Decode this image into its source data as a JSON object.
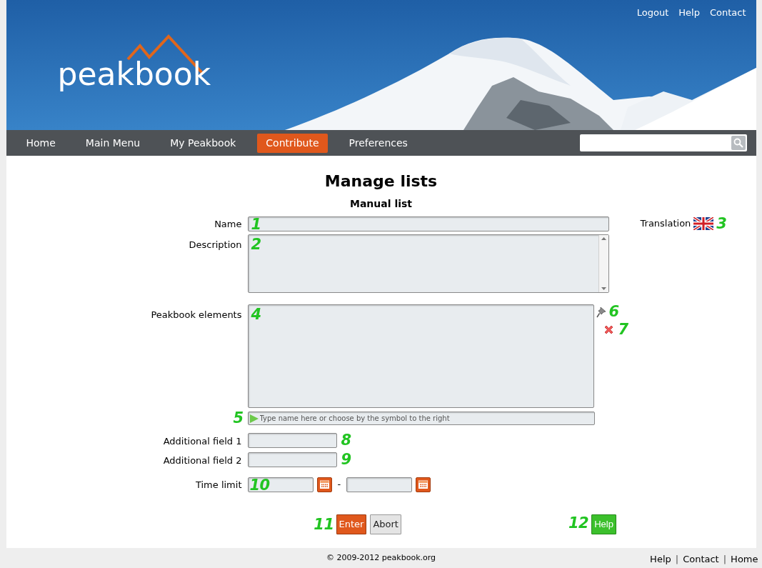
{
  "header": {
    "logo": "peakbook",
    "links": [
      "Logout",
      "Help",
      "Contact"
    ]
  },
  "nav": {
    "items": [
      {
        "label": "Home",
        "selected": false
      },
      {
        "label": "Main Menu",
        "selected": false
      },
      {
        "label": "My Peakbook",
        "selected": false
      },
      {
        "label": "Contribute",
        "selected": true
      },
      {
        "label": "Preferences",
        "selected": false
      }
    ]
  },
  "title": "Manage lists",
  "subtitle": "Manual list",
  "form": {
    "name": {
      "label": "Name",
      "marker": "1"
    },
    "translation": {
      "label": "Translation",
      "marker": "3"
    },
    "description": {
      "label": "Description",
      "marker": "2"
    },
    "elements": {
      "label": "Peakbook elements",
      "marker": "4",
      "pin_marker": "6",
      "remove_marker": "7"
    },
    "element_input": {
      "placeholder": "Type name here or choose by the symbol to the right",
      "marker": "5"
    },
    "additional_fields": [
      {
        "label": "Additional field 1",
        "marker": "8"
      },
      {
        "label": "Additional field 2",
        "marker": "9"
      }
    ],
    "time_limit": {
      "label": "Time limit",
      "marker": "10",
      "separator": "-"
    }
  },
  "buttons": {
    "enter": "Enter",
    "abort": "Abort",
    "help": "Help",
    "enter_marker": "11",
    "help_marker": "12"
  },
  "footer": {
    "copyright": "© 2009-2012 peakbook.org",
    "links": [
      "Help",
      "Contact",
      "Home"
    ],
    "separator": "|"
  }
}
